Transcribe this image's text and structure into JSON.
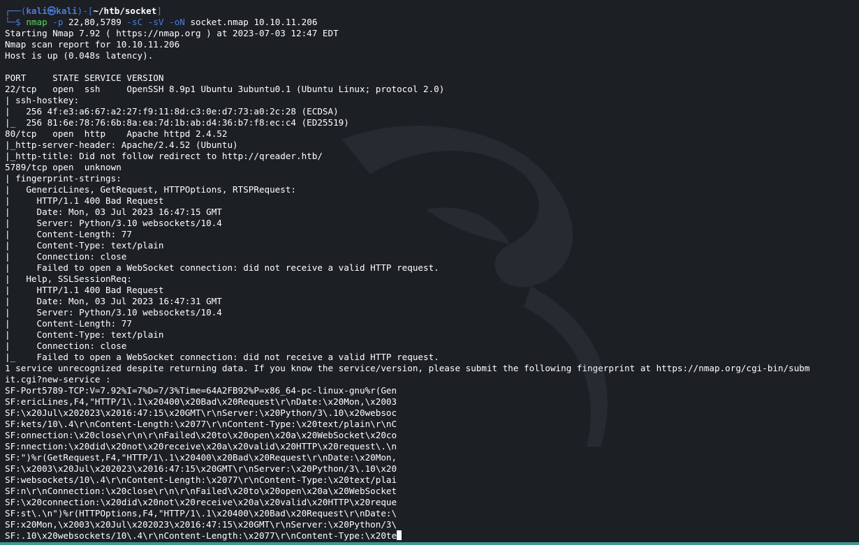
{
  "prompt": {
    "corner": "┌──(",
    "user": "kali㉿kali",
    "mid": ")-[",
    "path": "~/htb/socket",
    "close": "]",
    "cmd_prefix": "└─$ ",
    "command": "nmap",
    "args": [
      {
        "text": " -p",
        "kind": "flag"
      },
      {
        "text": " 22,80,5789",
        "kind": "arg"
      },
      {
        "text": " -sC",
        "kind": "flag"
      },
      {
        "text": " -sV",
        "kind": "flag"
      },
      {
        "text": " -oN",
        "kind": "flag"
      },
      {
        "text": " socket.nmap 10.10.11.206",
        "kind": "arg"
      }
    ]
  },
  "output": [
    "Starting Nmap 7.92 ( https://nmap.org ) at 2023-07-03 12:47 EDT",
    "Nmap scan report for 10.10.11.206",
    "Host is up (0.048s latency).",
    "",
    "PORT     STATE SERVICE VERSION",
    "22/tcp   open  ssh     OpenSSH 8.9p1 Ubuntu 3ubuntu0.1 (Ubuntu Linux; protocol 2.0)",
    "| ssh-hostkey:",
    "|   256 4f:e3:a6:67:a2:27:f9:11:8d:c3:0e:d7:73:a0:2c:28 (ECDSA)",
    "|_  256 81:6e:78:76:6b:8a:ea:7d:1b:ab:d4:36:b7:f8:ec:c4 (ED25519)",
    "80/tcp   open  http    Apache httpd 2.4.52",
    "|_http-server-header: Apache/2.4.52 (Ubuntu)",
    "|_http-title: Did not follow redirect to http://qreader.htb/",
    "5789/tcp open  unknown",
    "| fingerprint-strings:",
    "|   GenericLines, GetRequest, HTTPOptions, RTSPRequest:",
    "|     HTTP/1.1 400 Bad Request",
    "|     Date: Mon, 03 Jul 2023 16:47:15 GMT",
    "|     Server: Python/3.10 websockets/10.4",
    "|     Content-Length: 77",
    "|     Content-Type: text/plain",
    "|     Connection: close",
    "|     Failed to open a WebSocket connection: did not receive a valid HTTP request.",
    "|   Help, SSLSessionReq:",
    "|     HTTP/1.1 400 Bad Request",
    "|     Date: Mon, 03 Jul 2023 16:47:31 GMT",
    "|     Server: Python/3.10 websockets/10.4",
    "|     Content-Length: 77",
    "|     Content-Type: text/plain",
    "|     Connection: close",
    "|_    Failed to open a WebSocket connection: did not receive a valid HTTP request.",
    "1 service unrecognized despite returning data. If you know the service/version, please submit the following fingerprint at https://nmap.org/cgi-bin/subm",
    "it.cgi?new-service :",
    "SF-Port5789-TCP:V=7.92%I=7%D=7/3%Time=64A2FB92%P=x86_64-pc-linux-gnu%r(Gen",
    "SF:ericLines,F4,\"HTTP/1\\.1\\x20400\\x20Bad\\x20Request\\r\\nDate:\\x20Mon,\\x2003",
    "SF:\\x20Jul\\x202023\\x2016:47:15\\x20GMT\\r\\nServer:\\x20Python/3\\.10\\x20websoc",
    "SF:kets/10\\.4\\r\\nContent-Length:\\x2077\\r\\nContent-Type:\\x20text/plain\\r\\nC",
    "SF:onnection:\\x20close\\r\\n\\r\\nFailed\\x20to\\x20open\\x20a\\x20WebSocket\\x20co",
    "SF:nnection:\\x20did\\x20not\\x20receive\\x20a\\x20valid\\x20HTTP\\x20request\\.\\n",
    "SF:\")%r(GetRequest,F4,\"HTTP/1\\.1\\x20400\\x20Bad\\x20Request\\r\\nDate:\\x20Mon,",
    "SF:\\x2003\\x20Jul\\x202023\\x2016:47:15\\x20GMT\\r\\nServer:\\x20Python/3\\.10\\x20",
    "SF:websockets/10\\.4\\r\\nContent-Length:\\x2077\\r\\nContent-Type:\\x20text/plai",
    "SF:n\\r\\nConnection:\\x20close\\r\\n\\r\\nFailed\\x20to\\x20open\\x20a\\x20WebSocket",
    "SF:\\x20connection:\\x20did\\x20not\\x20receive\\x20a\\x20valid\\x20HTTP\\x20reque",
    "SF:st\\.\\n\")%r(HTTPOptions,F4,\"HTTP/1\\.1\\x20400\\x20Bad\\x20Request\\r\\nDate:\\",
    "SF:x20Mon,\\x2003\\x20Jul\\x202023\\x2016:47:15\\x20GMT\\r\\nServer:\\x20Python/3\\",
    "SF:.10\\x20websockets/10\\.4\\r\\nContent-Length:\\x2077\\r\\nContent-Type:\\x20te"
  ],
  "colors": {
    "background": "#1c1f24",
    "prompt_blue": "#4e7cd8",
    "command_green": "#5ed35e",
    "text": "#ffffff",
    "status_bar": "#3d9a8f"
  }
}
